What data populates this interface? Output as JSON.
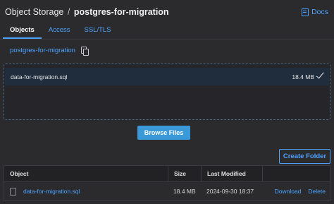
{
  "header": {
    "breadcrumb_root": "Object Storage",
    "breadcrumb_sep": "/",
    "breadcrumb_current": "postgres-for-migration",
    "docs_label": "Docs"
  },
  "tabs": [
    {
      "label": "Objects",
      "active": true
    },
    {
      "label": "Access",
      "active": false
    },
    {
      "label": "SSL/TLS",
      "active": false
    }
  ],
  "bucket": {
    "name": "postgres-for-migration"
  },
  "upload": {
    "file_name": "data-for-migration.sql",
    "file_size": "18.4 MB",
    "status_icon": "check-icon"
  },
  "buttons": {
    "browse": "Browse Files",
    "create_folder": "Create Folder"
  },
  "table": {
    "headers": [
      "Object",
      "Size",
      "Last Modified"
    ],
    "rows": [
      {
        "name": "data-for-migration.sql",
        "size": "18.4 MB",
        "modified": "2024-09-30 18:37",
        "actions": [
          "Download",
          "Delete"
        ]
      }
    ]
  },
  "colors": {
    "accent": "#4da3ff",
    "primary_button": "#3a9ad9",
    "background": "#2b2b2e"
  }
}
